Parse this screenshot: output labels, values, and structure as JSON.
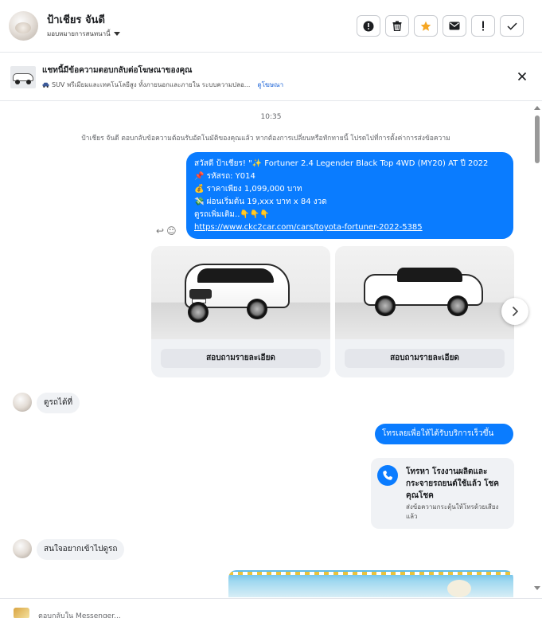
{
  "header": {
    "user_name": "ป้าเชียร จันดี",
    "assign_label": "มอบหมายการสนทนานี้",
    "actions": [
      "report-icon",
      "trash-icon",
      "star-icon",
      "mail-icon",
      "alert-icon",
      "check-icon"
    ]
  },
  "ad_context": {
    "title": "แชทนี้มีข้อความตอบกลับต่อโฆษณาของคุณ",
    "description": "SUV พรีเมียมและเทคโนโลยีสูง ทั้งภายนอกและภายใน ระบบความปลอ...",
    "link": "ดูโฆษณา"
  },
  "chat": {
    "timestamp": "10:35",
    "system_message": "ป้าเชียร จันดี ตอบกลับข้อความต้อนรับอัตโนมัติของคุณแล้ว หากต้องการเปลี่ยนหรือทักทายนี้ โปรดไปที่การตั้งค่าการส่งข้อความ",
    "outgoing_1": {
      "line1": "สวัสดี ป้าเชียร! \"✨ Fortuner 2.4 Legender Black Top 4WD (MY20) AT ปี 2022",
      "line2": "📌 รหัสรถ: Y014",
      "line3": "💰 ราคาเพียง 1,099,000 บาท",
      "line4": "💸 ผ่อนเริ่มต้น 19,xxx บาท x 84 งวด",
      "line5": "ดูรถเพิ่มเติม..👇👇👇",
      "url": "https://www.ckc2car.com/cars/toyota-fortuner-2022-5385"
    },
    "cards": [
      {
        "button": "สอบถามรายละเอียด"
      },
      {
        "button": "สอบถามรายละเอียด"
      }
    ],
    "incoming_1": "ดูรถได้ที่",
    "outgoing_2": "โทรเลยเพื่อให้ได้รับบริการเร็วขึ้น",
    "call_card": {
      "title": "โทรหา โรงงานผลิตและกระจายรถยนต์ใช้แล้ว โชคคุณโชค",
      "subtitle": "ส่งข้อความกระตุ้นให้โทรด้วยเสียงแล้ว"
    },
    "incoming_2": "สนใจอยากเข้าไปดูรถ"
  },
  "composer": {
    "placeholder": "ตอบกลับใน Messenger..."
  },
  "colors": {
    "accent": "#0a7cff",
    "star": "#f5a623",
    "bubble_in": "#f0f2f5"
  }
}
